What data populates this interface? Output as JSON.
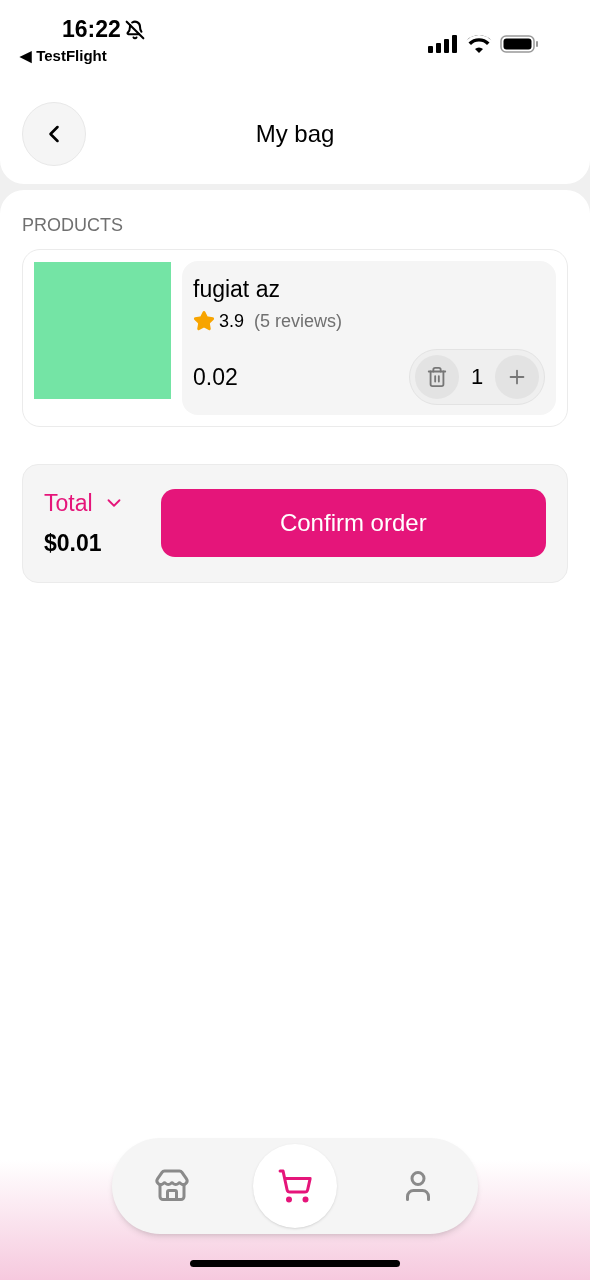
{
  "status_bar": {
    "time": "16:22",
    "back_app": "◀ TestFlight"
  },
  "header": {
    "title": "My bag"
  },
  "section_label": "PRODUCTS",
  "products": [
    {
      "name": "fugiat az",
      "rating": "3.9",
      "reviews": "(5 reviews)",
      "price": "0.02",
      "quantity": "1"
    }
  ],
  "summary": {
    "label": "Total",
    "amount": "$0.01",
    "button": "Confirm order"
  },
  "nav": [
    {
      "kind": "store",
      "selected": false
    },
    {
      "kind": "cart",
      "selected": true
    },
    {
      "kind": "profile",
      "selected": false
    }
  ]
}
